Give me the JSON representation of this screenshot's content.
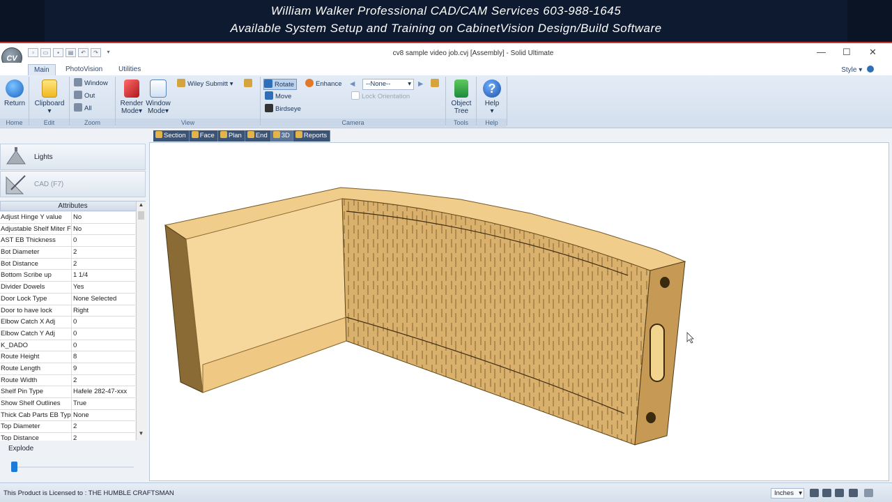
{
  "banner": {
    "line1": "William Walker Professional CAD/CAM Services 603-988-1645",
    "line2": "Available System Setup and Training on CabinetVision Design/Build Software"
  },
  "window": {
    "logo": "CV",
    "title": "cv8 sample video job.cvj [Assembly] - Solid Ultimate",
    "min": "—",
    "max": "☐",
    "close": "✕"
  },
  "ribbon_tabs": [
    "Main",
    "PhotoVision",
    "Utilities"
  ],
  "style_label": "Style",
  "ribbon": {
    "home": {
      "label": "Home",
      "return": "Return"
    },
    "edit": {
      "label": "Edit",
      "clipboard": "Clipboard"
    },
    "zoom": {
      "label": "Zoom",
      "window": "Window",
      "out": "Out",
      "all": "All"
    },
    "view": {
      "label": "View",
      "render1": "Render",
      "render2": "Mode",
      "wmode1": "Window",
      "wmode2": "Mode",
      "wiley": "Wiley Submitt"
    },
    "camera": {
      "label": "Camera",
      "rotate": "Rotate",
      "move": "Move",
      "birdseye": "Birdseye",
      "enhance": "Enhance",
      "none": "--None--",
      "lock": "Lock Orientation"
    },
    "tools": {
      "label": "Tools",
      "object1": "Object",
      "object2": "Tree"
    },
    "help": {
      "label": "Help",
      "help": "Help"
    }
  },
  "left_panel": {
    "lights": "Lights",
    "cad": "CAD (F7)",
    "attributes_header": "Attributes",
    "attributes": [
      {
        "k": "Adjust Hinge Y value",
        "v": "No"
      },
      {
        "k": "Adjustable Shelf Miter Fold",
        "v": "No"
      },
      {
        "k": "AST EB Thickness",
        "v": "0"
      },
      {
        "k": "Bot Diameter",
        "v": "2"
      },
      {
        "k": "Bot Distance",
        "v": "2"
      },
      {
        "k": "Bottom Scribe up",
        "v": "1 1/4"
      },
      {
        "k": "Divider Dowels",
        "v": "Yes"
      },
      {
        "k": "Door Lock Type",
        "v": "None Selected"
      },
      {
        "k": "Door to have lock",
        "v": "Right"
      },
      {
        "k": "Elbow Catch X Adj",
        "v": "0"
      },
      {
        "k": "Elbow Catch Y Adj",
        "v": "0"
      },
      {
        "k": "K_DADO",
        "v": "0"
      },
      {
        "k": "Route Height",
        "v": "8"
      },
      {
        "k": "Route Length",
        "v": "9"
      },
      {
        "k": "Route Width",
        "v": "2"
      },
      {
        "k": "Shelf Pin Type",
        "v": "Hafele 282-47-xxx"
      },
      {
        "k": "Show Shelf Outlines",
        "v": "True"
      },
      {
        "k": "Thick Cab Parts EB Type",
        "v": "None"
      },
      {
        "k": "Top Diameter",
        "v": "2"
      },
      {
        "k": "Top Distance",
        "v": "2"
      }
    ],
    "explode": "Explode",
    "explode_value": 0
  },
  "view_tabs": [
    "Section",
    "Face",
    "Plan",
    "End",
    "3D",
    "Reports"
  ],
  "active_view_tab": "3D",
  "status": {
    "license": "This Product is Licensed to : THE HUMBLE CRAFTSMAN",
    "units": "Inches"
  },
  "colors": {
    "wood_top": "#f3cf8a",
    "wood_inner": "#f6d79a",
    "wood_side": "#8a6a35",
    "wood_face": "#d6ad68",
    "accent": "#3b5374"
  }
}
